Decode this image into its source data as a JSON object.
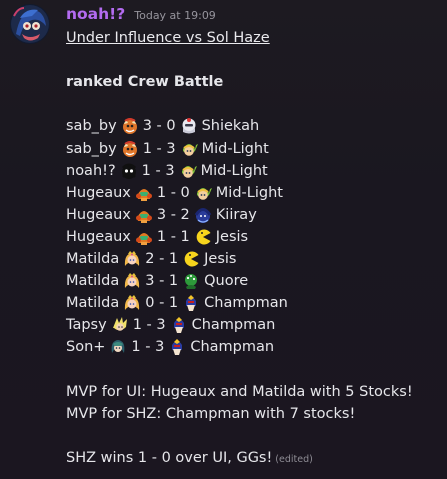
{
  "message": {
    "author": "noah!?",
    "timestamp": "Today at 19:09",
    "title": "Under Influence vs Sol Haze",
    "subtitle": "ranked Crew Battle",
    "matches": [
      {
        "p1": "sab_by",
        "p1_icon": "bowser-icon",
        "score": "3 - 0",
        "p2_icon": "sheik-icon",
        "p2": "Shiekah"
      },
      {
        "p1": "sab_by",
        "p1_icon": "bowser-icon",
        "score": "1 - 3",
        "p2_icon": "young-link-icon",
        "p2": "Mid-Light"
      },
      {
        "p1": "noah!?",
        "p1_icon": "mr-game-and-watch-icon",
        "score": "1 - 3",
        "p2_icon": "young-link-icon",
        "p2": "Mid-Light"
      },
      {
        "p1": "Hugeaux",
        "p1_icon": "samus-icon",
        "score": "1 - 0",
        "p2_icon": "young-link-icon",
        "p2": "Mid-Light"
      },
      {
        "p1": "Hugeaux",
        "p1_icon": "samus-icon",
        "score": "3 - 2",
        "p2_icon": "kirby-blue-icon",
        "p2": "Kiiray"
      },
      {
        "p1": "Hugeaux",
        "p1_icon": "samus-icon",
        "score": "1 - 1",
        "p2_icon": "pac-man-icon",
        "p2": "Jesis"
      },
      {
        "p1": "Matilda",
        "p1_icon": "peach-icon",
        "score": "2 - 1",
        "p2_icon": "pac-man-icon",
        "p2": "Jesis"
      },
      {
        "p1": "Matilda",
        "p1_icon": "peach-icon",
        "score": "3 - 1",
        "p2_icon": "piranha-plant-icon",
        "p2": "Quore"
      },
      {
        "p1": "Matilda",
        "p1_icon": "peach-icon",
        "score": "0 - 1",
        "p2_icon": "captain-falcon-icon",
        "p2": "Champman"
      },
      {
        "p1": "Tapsy",
        "p1_icon": "cloud-icon",
        "score": "1 - 3",
        "p2_icon": "captain-falcon-icon",
        "p2": "Champman"
      },
      {
        "p1": "Son+",
        "p1_icon": "byleth-icon",
        "score": "1 - 3",
        "p2_icon": "captain-falcon-icon",
        "p2": "Champman"
      }
    ],
    "mvp_ui": "MVP for UI: Hugeaux and Matilda with 5 Stocks!",
    "mvp_shz": "MVP for SHZ: Champman with 7 stocks!",
    "result": "SHZ wins 1 - 0 over UI, GGs!",
    "edited_label": "(edited)"
  },
  "colors": {
    "username": "#b36bf0",
    "text": "#e6e6ea",
    "muted": "#96949c"
  }
}
